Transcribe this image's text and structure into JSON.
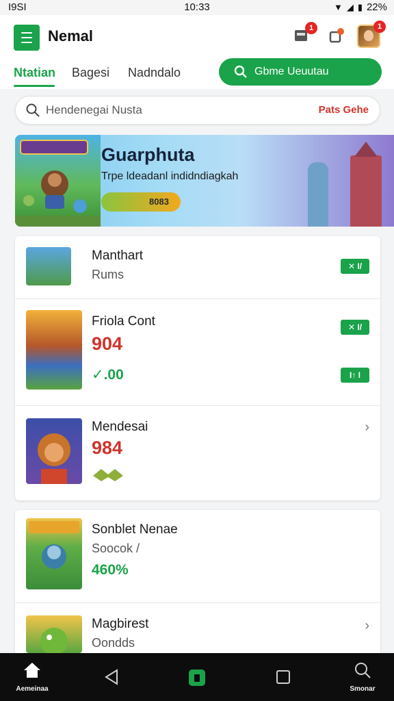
{
  "status_bar": {
    "left": "I9SI",
    "time": "10:33",
    "battery": "22%"
  },
  "header": {
    "title": "Nemal",
    "notif_badge_1": "1",
    "notif_badge_2": "1"
  },
  "tabs": [
    {
      "label": "Ntatian",
      "active": true
    },
    {
      "label": "Bagesi",
      "active": false
    },
    {
      "label": "Nadndalo",
      "active": false
    }
  ],
  "action_pill": {
    "label": "Gbme Ueuutau",
    "color": "#1aa34a"
  },
  "search": {
    "placeholder": "Hendenegai Nusta",
    "action": "Pats Gehe"
  },
  "banner": {
    "title": "Guarphuta",
    "subtitle": "Trpe ldeadanl indidndiagkah",
    "pill": "8083"
  },
  "list": [
    {
      "title": "Manthart",
      "sub": "Rums",
      "chip": "✕ I/"
    },
    {
      "title": "Friola Cont",
      "big": "904",
      "green": "✓.00",
      "chip": "✕ I/",
      "chip2": "I↑ I"
    },
    {
      "title": "Mendesai",
      "big": "984",
      "chevron": "›"
    },
    {
      "title": "Sonblet Nenae",
      "sub": "Soocok /",
      "green": "460%"
    },
    {
      "title": "Magbirest",
      "sub": "Oondds",
      "chevron": "›"
    }
  ],
  "bottom_nav": {
    "home_label": "Aemeinaa",
    "search_label": "Smonar"
  },
  "colors": {
    "brand": "#1aa34a",
    "accent_red": "#d0342c"
  }
}
